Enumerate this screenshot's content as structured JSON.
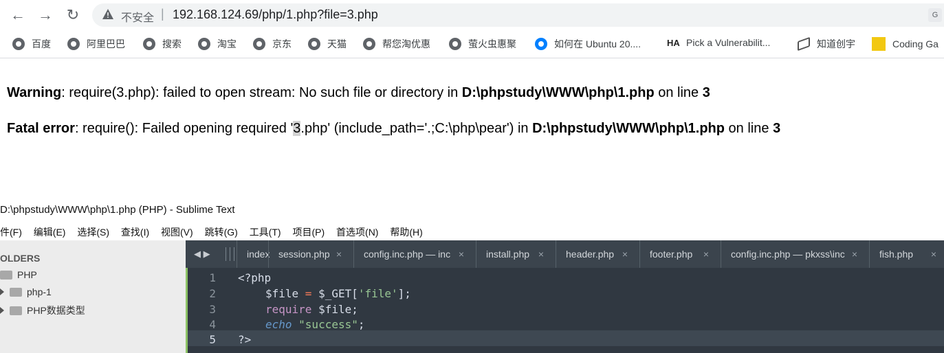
{
  "browser": {
    "insecure_label": "不安全",
    "separator": "|",
    "url": "192.168.124.69/php/1.php?file=3.php",
    "nav": {
      "back": "←",
      "forward": "→",
      "reload": "↻"
    },
    "translate_icon": "translate-icon"
  },
  "bookmarks": [
    {
      "label": "百度",
      "icon": "globe-icon"
    },
    {
      "label": "阿里巴巴",
      "icon": "globe-icon"
    },
    {
      "label": "搜索",
      "icon": "globe-icon"
    },
    {
      "label": "淘宝",
      "icon": "globe-icon"
    },
    {
      "label": "京东",
      "icon": "globe-icon"
    },
    {
      "label": "天猫",
      "icon": "globe-icon"
    },
    {
      "label": "帮您淘优惠",
      "icon": "globe-icon"
    },
    {
      "label": "萤火虫惠聚",
      "icon": "globe-icon"
    },
    {
      "label": "如何在 Ubuntu 20....",
      "icon": "digitalocean-icon"
    },
    {
      "label": "Pick a Vulnerabilit...",
      "icon": "ha-icon"
    },
    {
      "label": "知道创宇",
      "icon": "layers-icon"
    },
    {
      "label": "Coding Ga",
      "icon": "pencil-icon"
    }
  ],
  "page": {
    "warning": {
      "label": "Warning",
      "text": ": require(3.php): failed to open stream: No such file or directory in ",
      "path": "D:\\phpstudy\\WWW\\php\\1.php",
      "on_line": " on line ",
      "line": "3"
    },
    "fatal": {
      "label": "Fatal error",
      "text_pre": ": require(): Failed opening required '",
      "highlight": "3",
      "text_post": ".php' (include_path='.;C:\\php\\pear') in ",
      "path": "D:\\phpstudy\\WWW\\php\\1.php",
      "on_line": " on line ",
      "line": "3"
    }
  },
  "sublime": {
    "title": "D:\\phpstudy\\WWW\\php\\1.php (PHP) - Sublime Text",
    "menu": [
      "件(F)",
      "编辑(E)",
      "选择(S)",
      "查找(I)",
      "视图(V)",
      "跳转(G)",
      "工具(T)",
      "项目(P)",
      "首选项(N)",
      "帮助(H)"
    ],
    "sidebar": {
      "header": "OLDERS",
      "root": "PHP",
      "items": [
        "php-1",
        "PHP数据类型"
      ]
    },
    "tabnav": "◀ ▶",
    "tabs": [
      {
        "label": "index",
        "close": ""
      },
      {
        "label": "session.php",
        "close": "×"
      },
      {
        "label": "config.inc.php — inc",
        "close": "×"
      },
      {
        "label": "install.php",
        "close": "×"
      },
      {
        "label": "header.php",
        "close": "×"
      },
      {
        "label": "footer.php",
        "close": "×"
      },
      {
        "label": "config.inc.php — pkxss\\inc",
        "close": "×"
      },
      {
        "label": "fish.php",
        "close": "×"
      }
    ],
    "code_lines": [
      "1",
      "2",
      "3",
      "4",
      "5"
    ],
    "code": {
      "l1": "<?php",
      "l2_var": "$file",
      "l2_eq": " = ",
      "l2_get": "$_GET[",
      "l2_str": "'file'",
      "l2_end": "];",
      "l3_kw": "require",
      "l3_var": " $file",
      "l3_end": ";",
      "l4_kw": "echo",
      "l4_str": " \"success\"",
      "l4_end": ";",
      "l5": "?>"
    }
  }
}
